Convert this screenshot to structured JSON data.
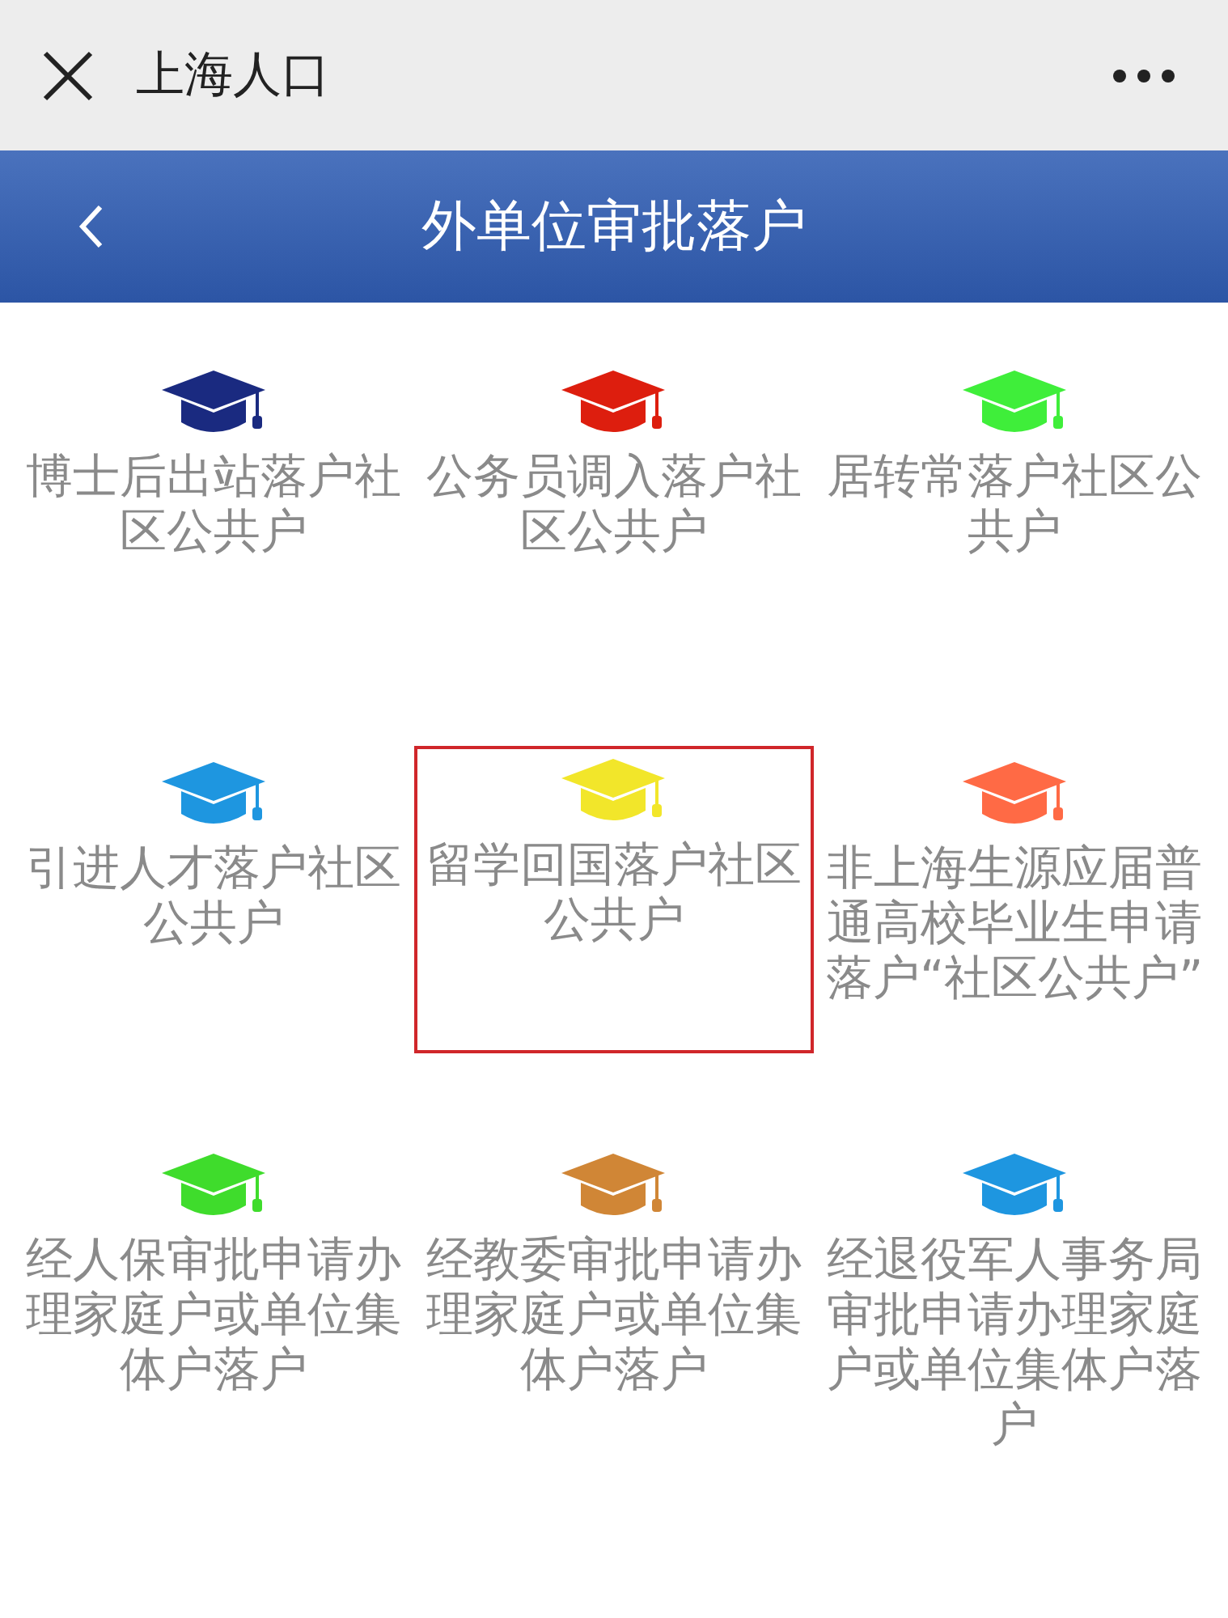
{
  "top_bar": {
    "title": "上海人口"
  },
  "header": {
    "title": "外单位审批落户"
  },
  "items": [
    {
      "label": "博士后出站落户社区公共户",
      "color": "#1a2a80",
      "selected": false
    },
    {
      "label": "公务员调入落户社区公共户",
      "color": "#dd1e0e",
      "selected": false
    },
    {
      "label": "居转常落户社区公共户",
      "color": "#3fee3a",
      "selected": false
    },
    {
      "label": "引进人才落户社区公共户",
      "color": "#1e96e0",
      "selected": false
    },
    {
      "label": "留学回国落户社区公共户",
      "color": "#f2e62a",
      "selected": true
    },
    {
      "label": "非上海生源应届普通高校毕业生申请落户“社区公共户”",
      "color": "#ff6a45",
      "selected": false
    },
    {
      "label": "经人保审批申请办理家庭户或单位集体户落户",
      "color": "#3fdc2c",
      "selected": false
    },
    {
      "label": "经教委审批申请办理家庭户或单位集体户落户",
      "color": "#d08636",
      "selected": false
    },
    {
      "label": "经退役军人事务局审批申请办理家庭户或单位集体户落户",
      "color": "#1e96e0",
      "selected": false
    }
  ]
}
